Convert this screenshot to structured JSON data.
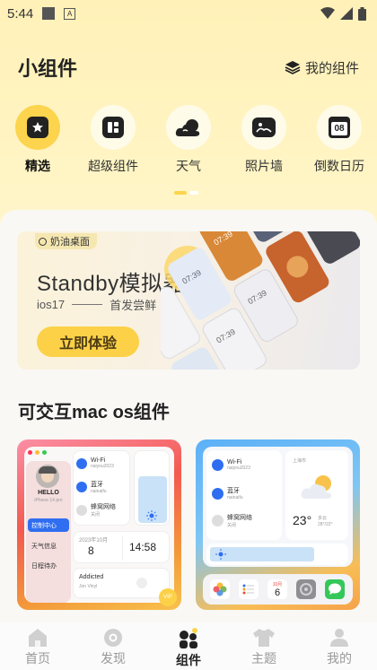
{
  "status_bar": {
    "time": "5:44",
    "notification_icons": [
      "square-icon",
      "font-a-icon"
    ],
    "right_icons": [
      "wifi-icon",
      "signal-icon",
      "battery-icon"
    ]
  },
  "header": {
    "title": "小组件",
    "my_widgets_label": "我的组件",
    "my_widgets_icon": "layers-icon"
  },
  "categories": [
    {
      "label": "精选",
      "icon": "star-icon",
      "active": true
    },
    {
      "label": "超级组件",
      "icon": "grid-icon",
      "active": false
    },
    {
      "label": "天气",
      "icon": "weather-icon",
      "active": false
    },
    {
      "label": "照片墙",
      "icon": "photo-icon",
      "active": false
    },
    {
      "label": "倒数日历",
      "icon": "calendar-icon",
      "active": false
    }
  ],
  "calendar_icon_day": "08",
  "banner": {
    "badge": "奶油桌面",
    "title": "Standby模拟器",
    "subtitle_left": "ios17",
    "subtitle_right": "首发尝鲜",
    "button": "立即体验",
    "clock_times": [
      "07:39",
      "07:39",
      "07:39",
      "07:39"
    ]
  },
  "section": {
    "title": "可交互mac os组件"
  },
  "widget_cards": [
    {
      "profile": {
        "name": "HELLO",
        "device": "iPhone 14 pro"
      },
      "menu": [
        "控制中心",
        "天气信息",
        "日程待办"
      ],
      "toggles": [
        {
          "label": "Wi-Fi",
          "sub": "naiyou2023"
        },
        {
          "label": "蓝牙",
          "sub": "nainaifu"
        },
        {
          "label": "蜂窝网络",
          "sub": "关闭"
        }
      ],
      "date_label": "2023年10月",
      "date_day": "8",
      "time": "14:58",
      "music": {
        "title": "Addicted",
        "artist": "Jon Vinyl"
      },
      "badge": "VIP"
    },
    {
      "toggles": [
        {
          "label": "Wi-Fi",
          "sub": "naiyou2023"
        },
        {
          "label": "蓝牙",
          "sub": "nainaifu"
        },
        {
          "label": "蜂窝网络",
          "sub": "关闭"
        }
      ],
      "weather": {
        "city": "上海市",
        "temp": "23°",
        "range": "多云",
        "range2": "28°/22°"
      },
      "dock_calendar": {
        "month": "10月",
        "day": "6"
      },
      "dock_icons": [
        "photos-icon",
        "reminders-icon",
        "calendar-icon",
        "settings-icon",
        "messages-icon"
      ]
    }
  ],
  "bottom_nav": [
    {
      "label": "首页",
      "icon": "home-icon",
      "active": false
    },
    {
      "label": "发现",
      "icon": "discover-icon",
      "active": false
    },
    {
      "label": "组件",
      "icon": "widgets-icon",
      "active": true
    },
    {
      "label": "主题",
      "icon": "shirt-icon",
      "active": false
    },
    {
      "label": "我的",
      "icon": "profile-icon",
      "active": false
    }
  ],
  "colors": {
    "accent": "#fcd44d",
    "button": "#fcd148",
    "header_bg": "#fff1b8"
  }
}
